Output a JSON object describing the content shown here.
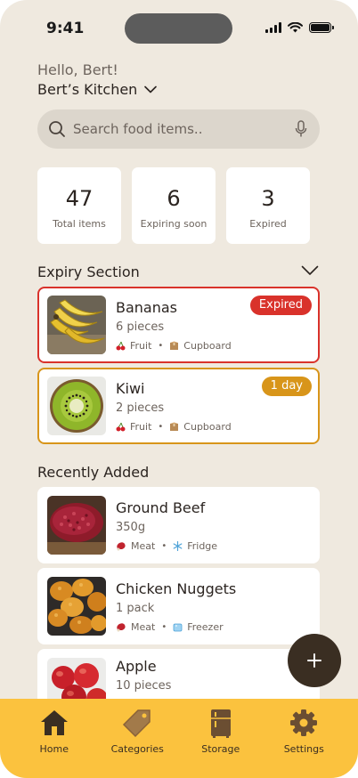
{
  "status": {
    "time": "9:41"
  },
  "header": {
    "greeting": "Hello, Bert!",
    "kitchen_name": "Bert’s Kitchen"
  },
  "search": {
    "placeholder": "Search food items.."
  },
  "stats": [
    {
      "value": "47",
      "label": "Total items"
    },
    {
      "value": "6",
      "label": "Expiring soon"
    },
    {
      "value": "3",
      "label": "Expired"
    }
  ],
  "expiry": {
    "title": "Expiry Section",
    "items": [
      {
        "name": "Bananas",
        "qty": "6 pieces",
        "category": "Fruit",
        "storage": "Cupboard",
        "badge": "Expired",
        "badge_color": "#d9322b",
        "border_color": "#d9322b"
      },
      {
        "name": "Kiwi",
        "qty": "2 pieces",
        "category": "Fruit",
        "storage": "Cupboard",
        "badge": "1 day",
        "badge_color": "#d8951a",
        "border_color": "#d8951a"
      }
    ]
  },
  "recent": {
    "title": "Recently Added",
    "items": [
      {
        "name": "Ground Beef",
        "qty": "350g",
        "category": "Meat",
        "storage": "Fridge"
      },
      {
        "name": "Chicken Nuggets",
        "qty": "1 pack",
        "category": "Meat",
        "storage": "Freezer"
      },
      {
        "name": "Apple",
        "qty": "10 pieces",
        "category": "",
        "storage": ""
      }
    ]
  },
  "icons": {
    "fruit": "cherry-icon",
    "cupboard": "box-icon",
    "meat": "meat-icon",
    "fridge": "snowflake-icon",
    "freezer": "ice-cube-icon"
  },
  "nav": [
    {
      "label": "Home",
      "icon": "home-icon"
    },
    {
      "label": "Categories",
      "icon": "tag-icon"
    },
    {
      "label": "Storage",
      "icon": "fridge-icon"
    },
    {
      "label": "Settings",
      "icon": "gear-icon"
    }
  ],
  "colors": {
    "background": "#efe9df",
    "nav": "#fbc23e",
    "fab": "#3a2e22",
    "expired": "#d9322b",
    "soon": "#d8951a"
  }
}
